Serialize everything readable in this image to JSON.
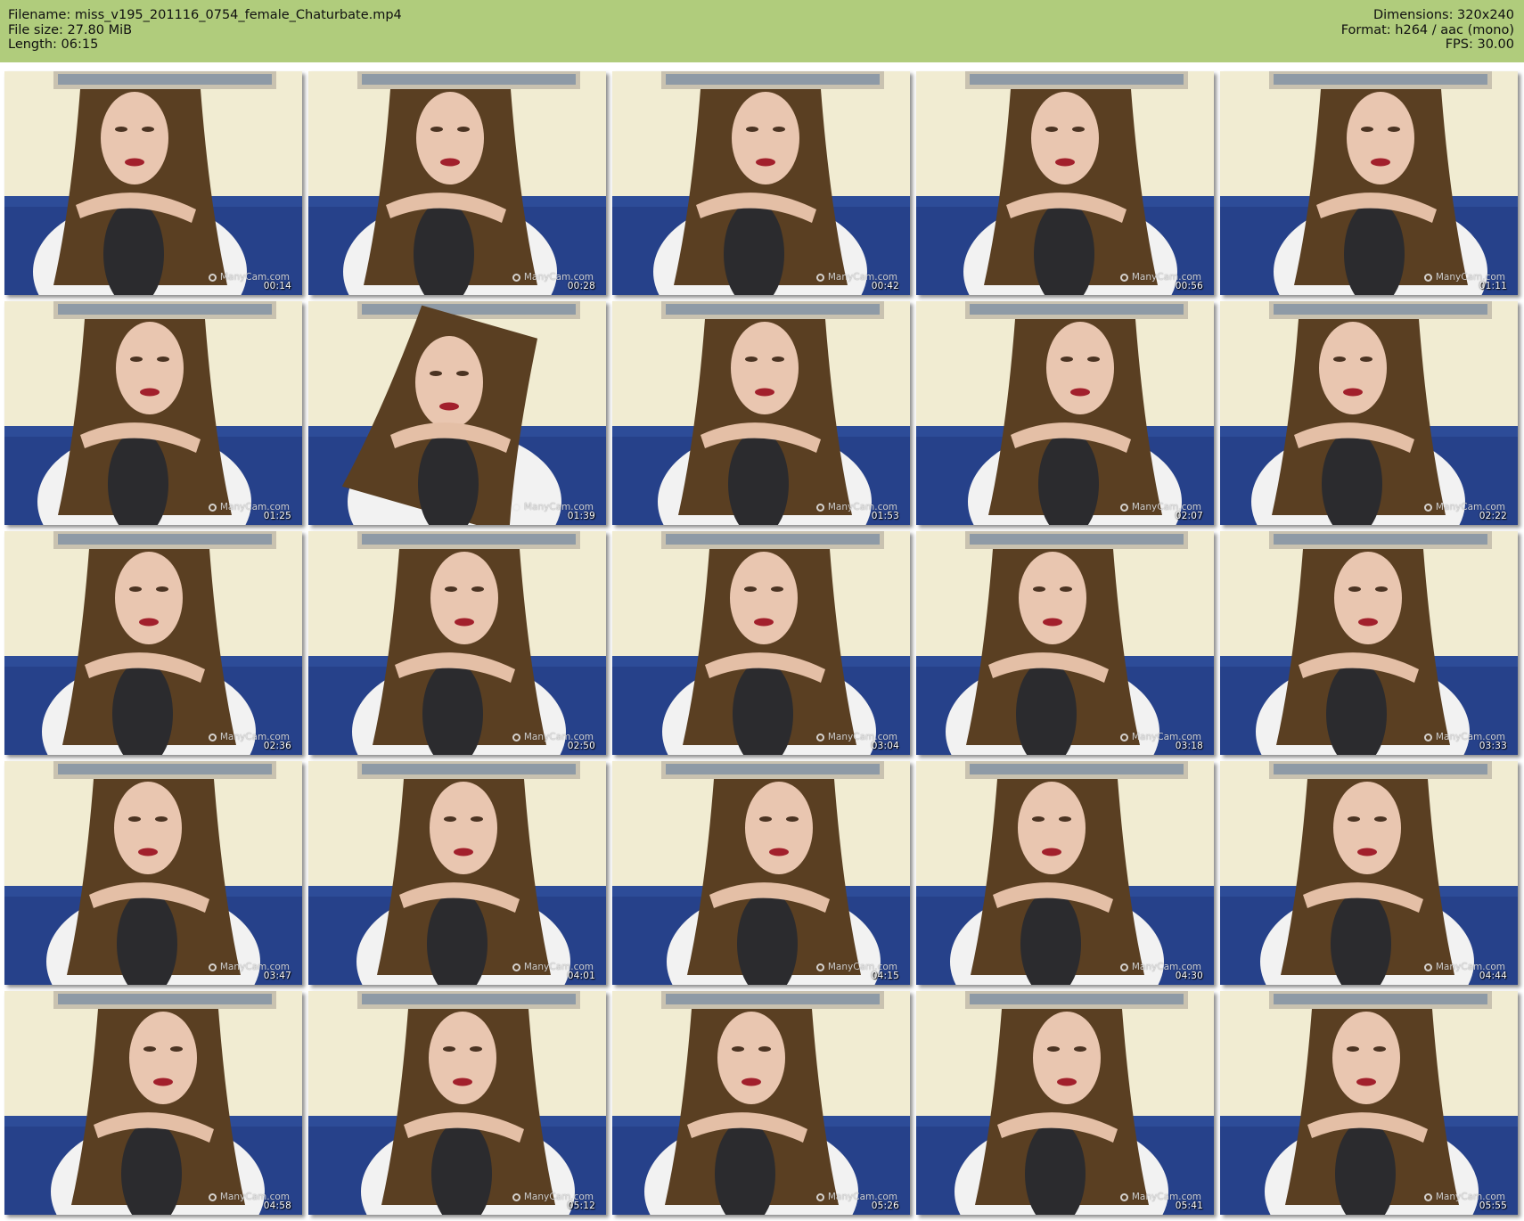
{
  "header": {
    "filename": "Filename: miss_v195_201116_0754_female_Chaturbate.mp4",
    "file_size": "File size: 27.80 MiB",
    "length": "Length: 06:15",
    "dimensions": "Dimensions: 320x240",
    "format": "Format: h264 / aac (mono)",
    "fps": "FPS: 30.00"
  },
  "colors": {
    "header_bg": "#b0cc7c",
    "wall": "#f1ecd2",
    "sofa": "#26418a",
    "hair": "#5a3f22",
    "shirt": "#f2f2f2",
    "leggings": "#2b2b2e"
  },
  "watermark": "ManyCam.com",
  "thumbnails": [
    {
      "time": "00:14"
    },
    {
      "time": "00:28"
    },
    {
      "time": "00:42"
    },
    {
      "time": "00:56"
    },
    {
      "time": "01:11"
    },
    {
      "time": "01:25"
    },
    {
      "time": "01:39"
    },
    {
      "time": "01:53"
    },
    {
      "time": "02:07"
    },
    {
      "time": "02:22"
    },
    {
      "time": "02:36"
    },
    {
      "time": "02:50"
    },
    {
      "time": "03:04"
    },
    {
      "time": "03:18"
    },
    {
      "time": "03:33"
    },
    {
      "time": "03:47"
    },
    {
      "time": "04:01"
    },
    {
      "time": "04:15"
    },
    {
      "time": "04:30"
    },
    {
      "time": "04:44"
    },
    {
      "time": "04:58"
    },
    {
      "time": "05:12"
    },
    {
      "time": "05:26"
    },
    {
      "time": "05:41"
    },
    {
      "time": "05:55"
    }
  ]
}
